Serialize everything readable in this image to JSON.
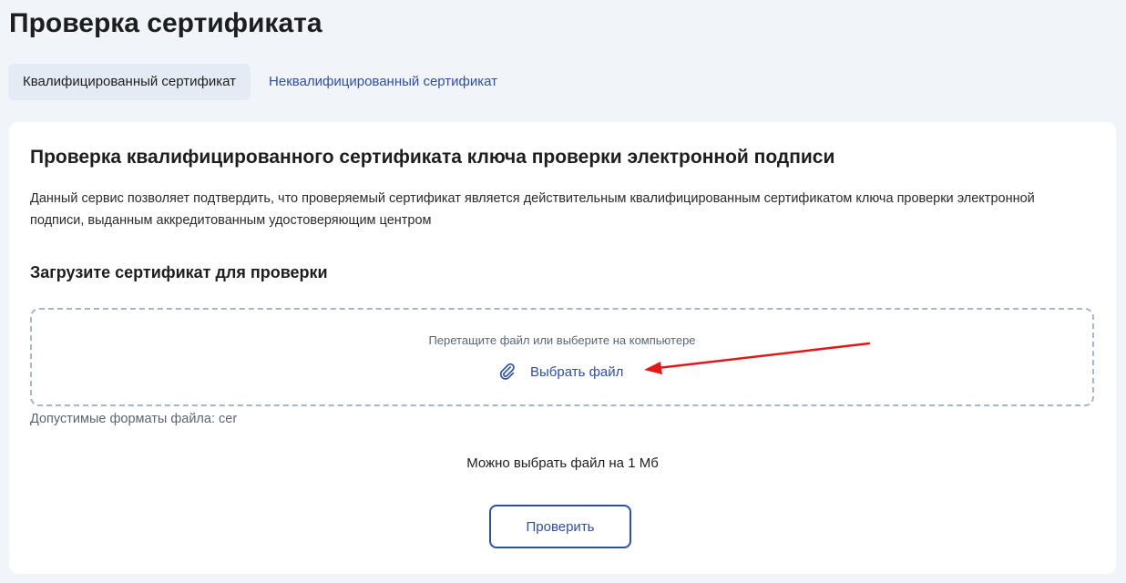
{
  "page": {
    "title": "Проверка сертификата"
  },
  "tabs": [
    {
      "label": "Квалифицированный сертификат",
      "active": true
    },
    {
      "label": "Неквалифицированный сертификат",
      "active": false
    }
  ],
  "card": {
    "title": "Проверка квалифицированного сертификата ключа проверки электронной подписи",
    "description": "Данный сервис позволяет подтвердить, что проверяемый сертификат является действительным квалифицированным сертификатом ключа проверки электронной подписи, выданным аккредитованным удостоверяющим центром",
    "upload_title": "Загрузите сертификат для проверки",
    "dropzone": {
      "hint": "Перетащите файл или выберите на компьютере",
      "choose_label": "Выбрать файл",
      "icon": "paperclip-icon"
    },
    "formats": "Допустимые форматы файла: cer",
    "size_note": "Можно выбрать файл на 1 Мб",
    "check_button": "Проверить"
  },
  "colors": {
    "accent": "#2d4fa8",
    "background": "#f1f4f8",
    "tab_active_bg": "#e4ebf4",
    "annotation_arrow": "#e01818"
  }
}
